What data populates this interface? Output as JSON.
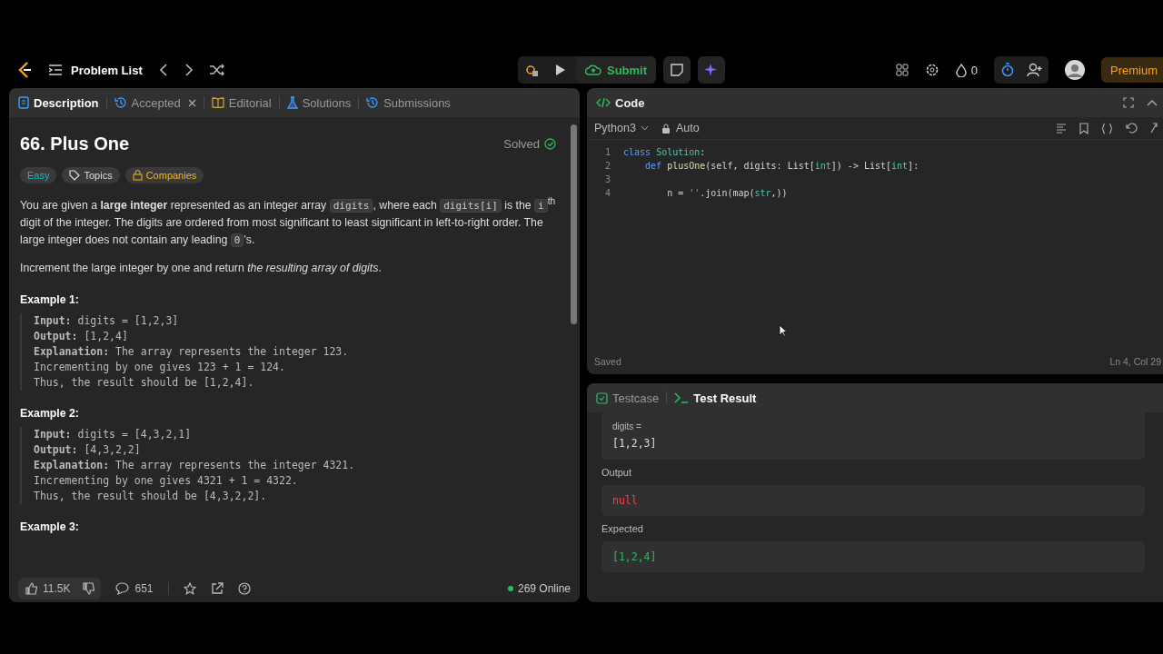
{
  "nav": {
    "problem_list": "Problem List",
    "submit": "Submit",
    "streak": "0",
    "premium": "Premium"
  },
  "left_tabs": [
    {
      "label": "Description",
      "selected": true,
      "kind": "description"
    },
    {
      "label": "Accepted",
      "selected": false,
      "kind": "accepted"
    },
    {
      "label": "Editorial",
      "selected": false,
      "kind": "editorial"
    },
    {
      "label": "Solutions",
      "selected": false,
      "kind": "solutions"
    },
    {
      "label": "Submissions",
      "selected": false,
      "kind": "submissions"
    }
  ],
  "problem": {
    "title": "66. Plus One",
    "status": "Solved",
    "tags": [
      {
        "label": "Easy",
        "kind": "difficulty"
      },
      {
        "label": "Topics",
        "kind": "topics"
      },
      {
        "label": "Companies",
        "kind": "companies"
      }
    ],
    "paragraphs": [
      [
        {
          "kind": "text",
          "text": "You are given a **large integer** represented as an integer array "
        },
        {
          "kind": "code",
          "text": "digits"
        },
        {
          "kind": "text",
          "text": ", where each "
        },
        {
          "kind": "code",
          "text": "digits[i]"
        },
        {
          "kind": "text",
          "text": " is the "
        },
        {
          "kind": "code",
          "text": "i"
        },
        {
          "kind": "text",
          "text": "$^{th}$ digit of the integer. The digits are ordered from most significant to least significant in left-to-right order. The large integer does not contain any leading "
        },
        {
          "kind": "code",
          "text": "0"
        },
        {
          "kind": "text",
          "text": "'s."
        }
      ],
      [
        {
          "kind": "text",
          "text": "Increment the large integer by one and return *the resulting array of digits*."
        }
      ]
    ],
    "examples": [
      {
        "title": "Example 1:",
        "lines": [
          "**Input:** digits = [1,2,3]",
          "**Output:** [1,2,4]",
          "**Explanation:** The array represents the integer 123.",
          "Incrementing by one gives 123 + 1 = 124.",
          "Thus, the result should be [1,2,4]."
        ]
      },
      {
        "title": "Example 2:",
        "lines": [
          "**Input:** digits = [4,3,2,1]",
          "**Output:** [4,3,2,2]",
          "**Explanation:** The array represents the integer 4321.",
          "Incrementing by one gives 4321 + 1 = 4322.",
          "Thus, the result should be [4,3,2,2]."
        ]
      },
      {
        "title": "Example 3:"
      }
    ]
  },
  "footer": {
    "likes": "11.5K",
    "comments": "651",
    "online": "269 Online"
  },
  "code_panel": {
    "title": "Code",
    "language": "Python3",
    "mode": "Auto",
    "status": "Saved",
    "cursor": "Ln 4, Col 29",
    "lines": [
      {
        "number": "1",
        "tokens": [
          {
            "kind": "keyword",
            "text": "class "
          },
          {
            "kind": "type",
            "text": "Solution"
          },
          {
            "kind": "plain",
            "text": ":"
          }
        ]
      },
      {
        "number": "2",
        "tokens": [
          {
            "kind": "keyword",
            "text": "    def "
          },
          {
            "kind": "func",
            "text": "plusOne"
          },
          {
            "kind": "plain",
            "text": "(self, digits: List["
          },
          {
            "kind": "type",
            "text": "int"
          },
          {
            "kind": "plain",
            "text": "]) -> List["
          },
          {
            "kind": "type",
            "text": "int"
          },
          {
            "kind": "plain",
            "text": "]:"
          }
        ]
      },
      {
        "number": "3"
      },
      {
        "number": "4",
        "tokens": [
          {
            "kind": "plain",
            "text": "        n = "
          },
          {
            "kind": "string",
            "text": "''"
          },
          {
            "kind": "plain",
            "text": ".join(map("
          },
          {
            "kind": "type",
            "text": "str"
          },
          {
            "kind": "plain",
            "text": ",))"
          }
        ]
      }
    ]
  },
  "result_panel": {
    "tabs": [
      {
        "label": "Testcase",
        "selected": false,
        "kind": "testcase"
      },
      {
        "label": "Test Result",
        "selected": true,
        "kind": "result"
      }
    ],
    "input_label": "digits =",
    "input_value": "[1,2,3]",
    "sections": [
      {
        "label": "Output",
        "value": "null",
        "kind": "error"
      },
      {
        "label": "Expected",
        "value": "[1,2,4]",
        "kind": "ok"
      }
    ]
  }
}
